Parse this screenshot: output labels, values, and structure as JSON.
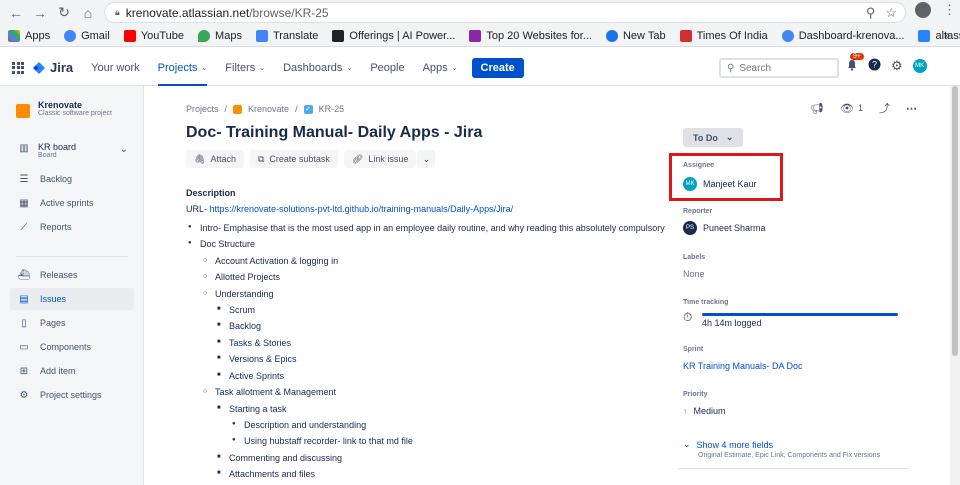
{
  "browser": {
    "url_host": "krenovate.atlassian.net",
    "url_path": "/browse/KR-25",
    "bookmarks": [
      "Apps",
      "Gmail",
      "YouTube",
      "Maps",
      "Translate",
      "Offerings | AI Power...",
      "Top 20 Websites for...",
      "New Tab",
      "Times Of India",
      "Dashboard-krenova...",
      "altassian - jira"
    ],
    "more": "»"
  },
  "topnav": {
    "logo": "Jira",
    "items": [
      "Your work",
      "Projects",
      "Filters",
      "Dashboards",
      "People",
      "Apps"
    ],
    "create": "Create",
    "search_placeholder": "Search",
    "notif_count": "9+",
    "avatar": "MK"
  },
  "sidebar": {
    "project_name": "Krenovate",
    "project_type": "Classic software project",
    "board_title": "KR board",
    "board_sub": "Board",
    "items": [
      "Backlog",
      "Active sprints",
      "Reports",
      "Releases",
      "Issues",
      "Pages",
      "Components",
      "Add item",
      "Project settings"
    ]
  },
  "issue": {
    "breadcrumb": [
      "Projects",
      "Krenovate",
      "KR-25"
    ],
    "title": "Doc- Training Manual- Daily Apps - Jira",
    "actions": [
      "Attach",
      "Create subtask",
      "Link issue"
    ],
    "description_label": "Description",
    "url_prefix": "URL- ",
    "url": "https://krenovate-solutions-pvt-ltd.github.io/training-manuals/Daily-Apps/Jira/",
    "bullets": [
      "Intro- Emphasise that is the most used app in an employee daily routine, and why reading this absolutely compulsory",
      "Doc Structure",
      "Account Activation & logging in",
      "Allotted Projects",
      "Understanding",
      "Scrum",
      "Backlog",
      "Tasks & Stories",
      "Versions & Epics",
      "Active Sprints",
      "Task allotment & Management",
      "Starting a task",
      "Description and understanding",
      "Using hubstaff recorder- link to that md file",
      "Commenting and discussing",
      "Attachments and files"
    ]
  },
  "details": {
    "watch_count": "1",
    "status": "To Do",
    "assignee_label": "Assignee",
    "assignee": "Manjeet Kaur",
    "assignee_initials": "MK",
    "reporter_label": "Reporter",
    "reporter": "Puneet Sharma",
    "reporter_initials": "PS",
    "labels_label": "Labels",
    "labels": "None",
    "time_label": "Time tracking",
    "time_logged": "4h 14m logged",
    "time_progress": 1.0,
    "sprint_label": "Sprint",
    "sprint": "KR Training Manuals- DA Doc",
    "priority_label": "Priority",
    "priority": "Medium",
    "show_more": "Show 4 more fields",
    "show_more_sub": "Original Estimate, Epic Link, Components and Fix versions"
  },
  "colors": {
    "accent": "#0052cc",
    "highlight": "#e0161d",
    "priority": "#ff8b00"
  }
}
